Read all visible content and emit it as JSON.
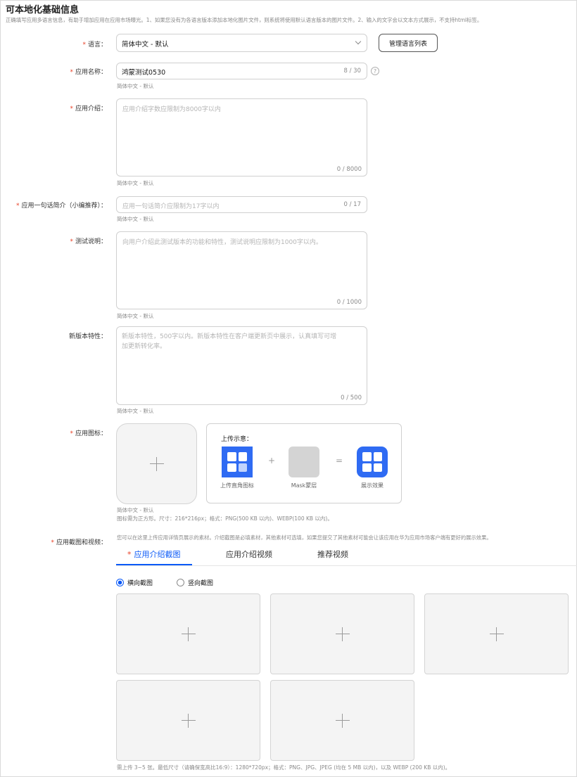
{
  "header": {
    "title": "可本地化基础信息",
    "notice": "正确填写应用多语言信息，有助于增加应用在应用市场曝光。1、如果您没有为各语言版本添加本地化图片文件，则系统将使用默认语言版本的图片文件。2、输入的文字会以文本方式展示，不支持html标签。"
  },
  "language": {
    "label": "语言：",
    "value": "简体中文 - 默认",
    "manage_button": "管理语言列表"
  },
  "app_name": {
    "label": "应用名称：",
    "value": "鸿蒙测试0530",
    "counter": "8 / 30",
    "hint": "简体中文 - 默认"
  },
  "app_intro": {
    "label": "应用介绍：",
    "placeholder": "应用介绍字数应限制为8000字以内",
    "counter": "0 / 8000",
    "hint": "简体中文 - 默认"
  },
  "one_line_intro": {
    "label": "应用一句话简介（小编推荐）：",
    "placeholder": "应用一句话简介应限制为17字以内",
    "counter": "0 / 17",
    "hint": "简体中文 - 默认"
  },
  "test_notes": {
    "label": "测试说明：",
    "placeholder": "向用户介绍此测试版本的功能和特性，测试说明应限制为1000字以内。",
    "counter": "0 / 1000",
    "hint": "简体中文 - 默认"
  },
  "new_features": {
    "label": "新版本特性：",
    "placeholder_line1": "新版本特性，500字以内。新版本特性在客户端更新页中展示，认真填写可增",
    "placeholder_line2": "加更新转化率。",
    "counter": "0 / 500",
    "hint": "简体中文 - 默认"
  },
  "app_icon": {
    "label": "应用图标：",
    "demo_title": "上传示意：",
    "demo_items": [
      "上传直角图标",
      "Mask蒙层",
      "展示效果"
    ],
    "plus_sign": "+",
    "equals_sign": "=",
    "hint": "简体中文 - 默认",
    "spec": "图标需为正方形。尺寸：216*216px；格式：PNG(500 KB 以内)、WEBP(100 KB 以内)。",
    "colors": {
      "brand": "#2f6bf3",
      "mask": "#d4d4d4"
    }
  },
  "screenshots": {
    "label": "应用截图和视频：",
    "description": "您可以在这里上传应用详情页展示的素材。介绍截图是必填素材，其他素材可选填，如果您提交了其他素材可能会让该应用在华为应用市场客户端有更好的展示效果。",
    "tabs": [
      {
        "label": "应用介绍截图",
        "required": "*"
      },
      {
        "label": "应用介绍视频"
      },
      {
        "label": "推荐视频"
      }
    ],
    "orientation": {
      "landscape": "横向截图",
      "portrait": "竖向截图",
      "selected": "横向截图"
    },
    "slots": 5,
    "requirements": "需上传 3~5 张。最低尺寸（请确保宽高比16:9）：1280*720px；格式：PNG、JPG、JPEG (均在 5 MB 以内)，以及 WEBP (200 KB 以内)。"
  },
  "common": {
    "required_mark": "*"
  },
  "colors": {
    "accent": "#0a59f7",
    "required": "#e84026"
  }
}
